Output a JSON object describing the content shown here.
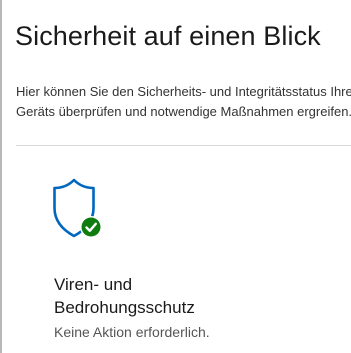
{
  "header": {
    "title": "Sicherheit auf einen Blick",
    "description_line1": "Hier können Sie den Sicherheits- und Integritätsstatus Ihres",
    "description_line2": "Geräts überprüfen und notwendige Maßnahmen ergreifen."
  },
  "tile": {
    "icon": "shield-check-icon",
    "title_line1": "Viren- und",
    "title_line2": "Bedrohungsschutz",
    "status": "Keine Aktion erforderlich."
  },
  "colors": {
    "accent": "#0067c0",
    "ok": "#107c10"
  }
}
